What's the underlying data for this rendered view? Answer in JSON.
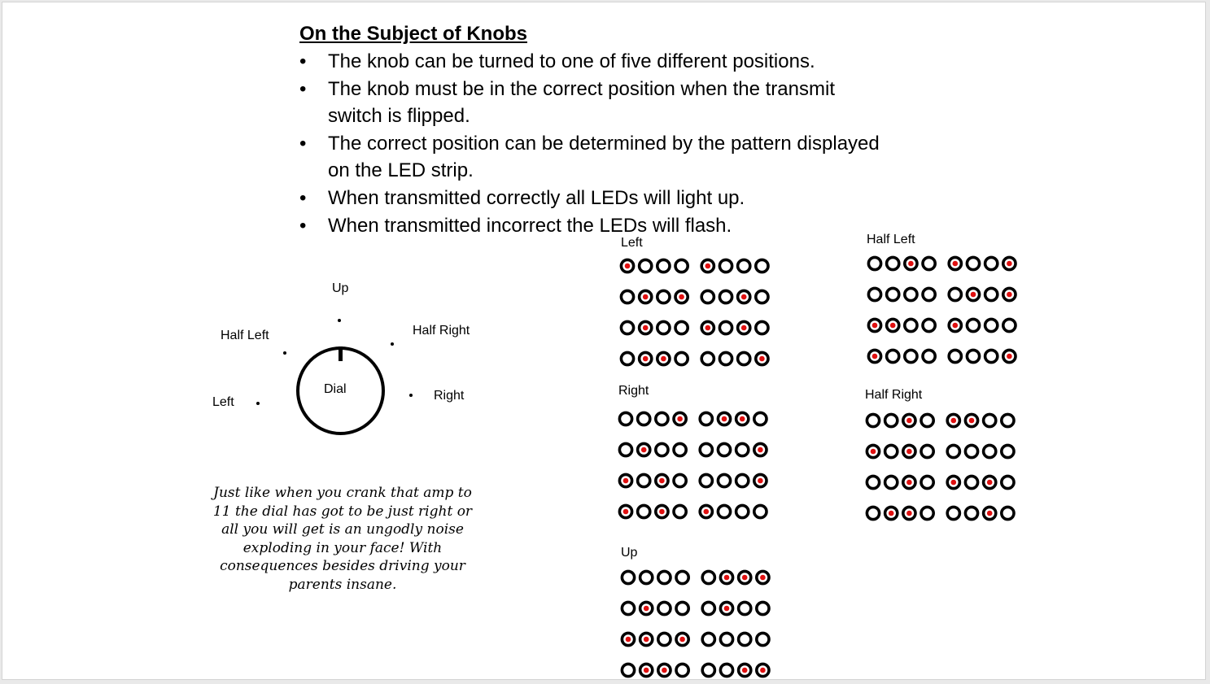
{
  "title": "On the Subject of Knobs",
  "bullets": [
    "The knob can be turned to one of five different positions.",
    "The knob must be in the correct position when the transmit switch is flipped.",
    "The correct position can be determined by the pattern displayed on the LED strip.",
    "When transmitted correctly all LEDs will light up.",
    "When transmitted incorrect the LEDs will flash."
  ],
  "bullet_glyph": "•",
  "dial": {
    "center_label": "Dial",
    "labels": {
      "up": "Up",
      "half_left": "Half Left",
      "half_right": "Half Right",
      "left": "Left",
      "right": "Right"
    }
  },
  "note": "Just like when you crank that amp to 11 the dial has got to be just right or all you will get is an ungodly noise exploding in your face! With consequences besides driving your parents insane.",
  "colors": {
    "led_lit": "#e01010",
    "led_ring": "#000000",
    "led_off_center": "#ffffff"
  },
  "led_panels": [
    {
      "id": "left",
      "label": "Left",
      "rows": [
        [
          1,
          0,
          0,
          0,
          1,
          0,
          0,
          0
        ],
        [
          0,
          1,
          0,
          1,
          0,
          0,
          1,
          0
        ],
        [
          0,
          1,
          0,
          0,
          1,
          0,
          1,
          0
        ],
        [
          0,
          1,
          1,
          0,
          0,
          0,
          0,
          1
        ]
      ]
    },
    {
      "id": "half-left",
      "label": "Half Left",
      "rows": [
        [
          0,
          0,
          1,
          0,
          1,
          0,
          0,
          1
        ],
        [
          0,
          0,
          0,
          0,
          0,
          1,
          0,
          1
        ],
        [
          1,
          1,
          0,
          0,
          1,
          0,
          0,
          0
        ],
        [
          1,
          0,
          0,
          0,
          0,
          0,
          0,
          1
        ]
      ]
    },
    {
      "id": "right",
      "label": "Right",
      "rows": [
        [
          0,
          0,
          0,
          1,
          0,
          1,
          1,
          0
        ],
        [
          0,
          1,
          0,
          0,
          0,
          0,
          0,
          1
        ],
        [
          1,
          0,
          1,
          0,
          0,
          0,
          0,
          1
        ],
        [
          1,
          0,
          1,
          0,
          1,
          0,
          0,
          0
        ]
      ]
    },
    {
      "id": "half-right",
      "label": "Half Right",
      "rows": [
        [
          0,
          0,
          1,
          0,
          1,
          1,
          0,
          0
        ],
        [
          1,
          0,
          1,
          0,
          0,
          0,
          0,
          0
        ],
        [
          0,
          0,
          1,
          0,
          1,
          0,
          1,
          0
        ],
        [
          0,
          1,
          1,
          0,
          0,
          0,
          1,
          0
        ]
      ]
    },
    {
      "id": "up",
      "label": "Up",
      "rows": [
        [
          0,
          0,
          0,
          0,
          0,
          1,
          1,
          1
        ],
        [
          0,
          1,
          0,
          0,
          0,
          1,
          0,
          0
        ],
        [
          1,
          1,
          0,
          1,
          0,
          0,
          0,
          0
        ],
        [
          0,
          1,
          1,
          0,
          0,
          0,
          1,
          1
        ]
      ]
    }
  ]
}
